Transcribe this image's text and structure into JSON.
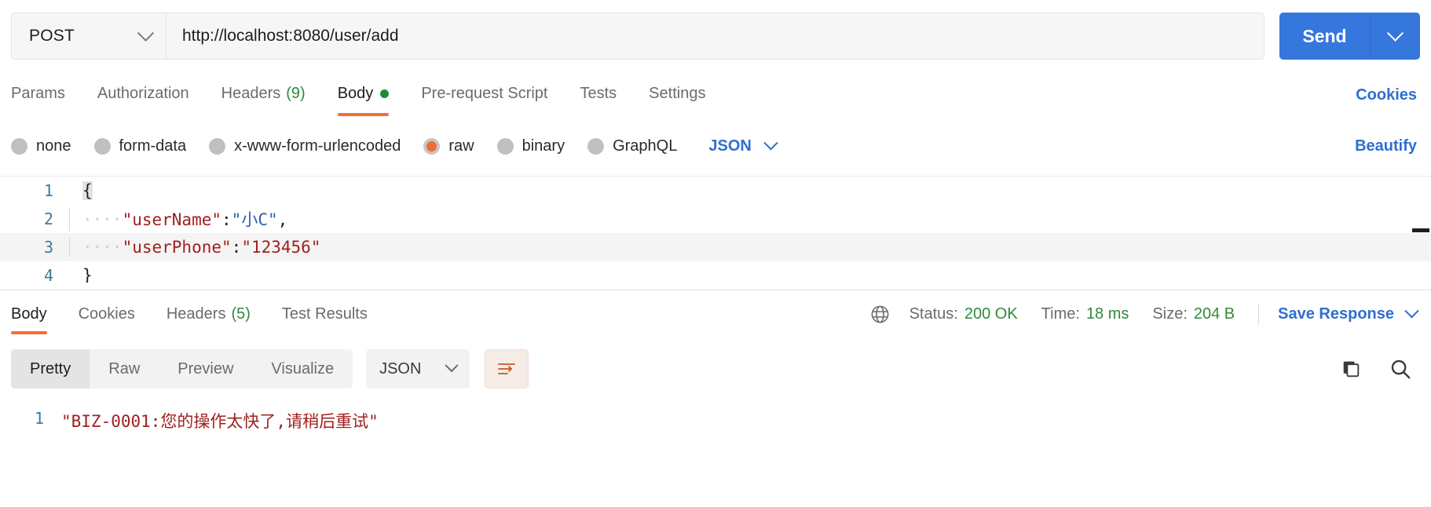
{
  "request": {
    "method": "POST",
    "url": "http://localhost:8080/user/add",
    "send_label": "Send",
    "tabs": [
      {
        "label": "Params",
        "active": false,
        "count": "",
        "dot": false
      },
      {
        "label": "Authorization",
        "active": false,
        "count": "",
        "dot": false
      },
      {
        "label": "Headers",
        "active": false,
        "count": "(9)",
        "dot": false
      },
      {
        "label": "Body",
        "active": true,
        "count": "",
        "dot": true
      },
      {
        "label": "Pre-request Script",
        "active": false,
        "count": "",
        "dot": false
      },
      {
        "label": "Tests",
        "active": false,
        "count": "",
        "dot": false
      },
      {
        "label": "Settings",
        "active": false,
        "count": "",
        "dot": false
      }
    ],
    "cookies_link": "Cookies",
    "body_types": [
      {
        "label": "none",
        "selected": false
      },
      {
        "label": "form-data",
        "selected": false
      },
      {
        "label": "x-www-form-urlencoded",
        "selected": false
      },
      {
        "label": "raw",
        "selected": true
      },
      {
        "label": "binary",
        "selected": false
      },
      {
        "label": "GraphQL",
        "selected": false
      }
    ],
    "body_language": "JSON",
    "beautify_label": "Beautify",
    "editor": {
      "lines": [
        {
          "num": "1",
          "indent": "",
          "text": "{",
          "kind": "punc",
          "highlight": false
        },
        {
          "num": "2",
          "indent": "····",
          "key": "\"userName\"",
          "colon": ":",
          "value": "\"小C\"",
          "trail": ",",
          "value_kind": "cn",
          "highlight": false
        },
        {
          "num": "3",
          "indent": "····",
          "key": "\"userPhone\"",
          "colon": ":",
          "value": "\"123456\"",
          "trail": "",
          "value_kind": "str",
          "highlight": true
        },
        {
          "num": "4",
          "indent": "",
          "text": "}",
          "kind": "punc",
          "highlight": false
        }
      ]
    }
  },
  "response": {
    "tabs": [
      {
        "label": "Body",
        "active": true,
        "count": ""
      },
      {
        "label": "Cookies",
        "active": false,
        "count": ""
      },
      {
        "label": "Headers",
        "active": false,
        "count": "(5)"
      },
      {
        "label": "Test Results",
        "active": false,
        "count": ""
      }
    ],
    "status": {
      "status_label": "Status:",
      "status_value": "200 OK",
      "time_label": "Time:",
      "time_value": "18 ms",
      "size_label": "Size:",
      "size_value": "204 B"
    },
    "save_response_label": "Save Response",
    "view_modes": [
      {
        "label": "Pretty",
        "active": true
      },
      {
        "label": "Raw",
        "active": false
      },
      {
        "label": "Preview",
        "active": false
      },
      {
        "label": "Visualize",
        "active": false
      }
    ],
    "format": "JSON",
    "body_lines": [
      {
        "num": "1",
        "text": "\"BIZ-0001:您的操作太快了,请稍后重试\""
      }
    ]
  },
  "colors": {
    "accent_orange": "#ef7138",
    "link_blue": "#2f6fd0",
    "send_blue": "#3577dd",
    "success_green": "#2f8a3c",
    "string_red": "#a02020",
    "gutter_blue": "#3d7a9c"
  }
}
